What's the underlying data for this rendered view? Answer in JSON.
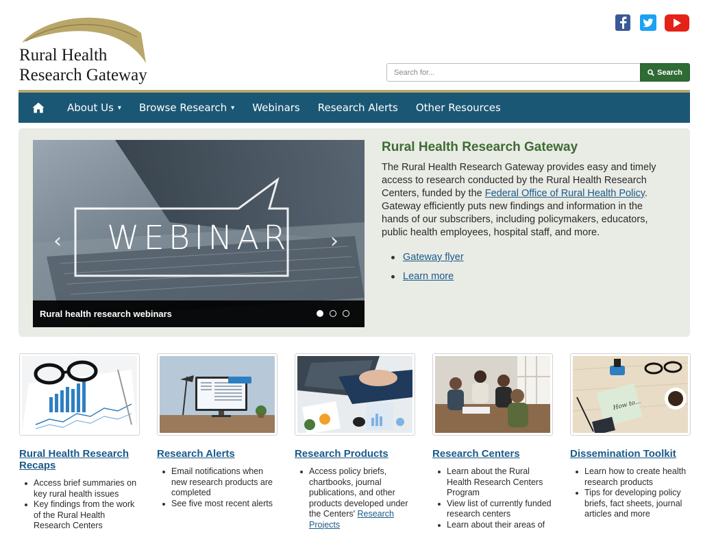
{
  "brand": {
    "line1": "Rural Health",
    "line2": "Research Gateway",
    "colors": {
      "nav": "#1a5774",
      "accent_green": "#2f6b35",
      "title_green": "#3e6b33",
      "gold": "#b9a76a",
      "link": "#1a5a8a"
    }
  },
  "social": [
    {
      "name": "facebook-icon",
      "glyph": "f"
    },
    {
      "name": "twitter-icon",
      "glyph": "t"
    },
    {
      "name": "youtube-icon",
      "glyph": "play"
    }
  ],
  "search": {
    "placeholder": "Search for...",
    "button_label": "Search",
    "icon": "search-icon"
  },
  "nav": {
    "home_icon": "home-icon",
    "items": [
      {
        "label": "About Us",
        "dropdown": true
      },
      {
        "label": "Browse Research",
        "dropdown": true
      },
      {
        "label": "Webinars",
        "dropdown": false
      },
      {
        "label": "Research Alerts",
        "dropdown": false
      },
      {
        "label": "Other Resources",
        "dropdown": false
      }
    ]
  },
  "carousel": {
    "overlay_text": "WEBINAR",
    "caption": "Rural health research webinars",
    "slide_count": 3,
    "active_index": 0
  },
  "hero": {
    "title": "Rural Health Research Gateway",
    "desc_before": "The Rural Health Research Gateway provides easy and timely access to research conducted by the Rural Health Research Centers, funded by the ",
    "desc_link": "Federal Office of Rural Health Policy",
    "desc_after": ". Gateway efficiently puts new findings and information in the hands of our subscribers, including policymakers, educators, public health employees, hospital staff, and more.",
    "links": [
      "Gateway flyer",
      "Learn more"
    ]
  },
  "cards": [
    {
      "title": "Rural Health Research Recaps",
      "bullets": [
        {
          "text": "Access brief summaries on key rural health issues"
        },
        {
          "text": "Key findings from the work of the Rural Health Research Centers"
        }
      ]
    },
    {
      "title": "Research Alerts",
      "bullets": [
        {
          "text": "Email notifications when new research products are completed"
        },
        {
          "text": "See five most recent alerts"
        }
      ]
    },
    {
      "title": "Research Products",
      "bullets": [
        {
          "text": "Access policy briefs, chartbooks, journal publications, and other products developed under the Centers'",
          "link": "Research Projects"
        }
      ]
    },
    {
      "title": "Research Centers",
      "bullets": [
        {
          "text": "Learn about the Rural Health Research Centers Program"
        },
        {
          "text": "View list of currently funded research centers"
        },
        {
          "text": "Learn about their areas of"
        }
      ]
    },
    {
      "title": "Dissemination Toolkit",
      "bullets": [
        {
          "text": "Learn how to create health research products"
        },
        {
          "text": "Tips for developing policy briefs, fact sheets, journal articles and more"
        }
      ]
    }
  ]
}
